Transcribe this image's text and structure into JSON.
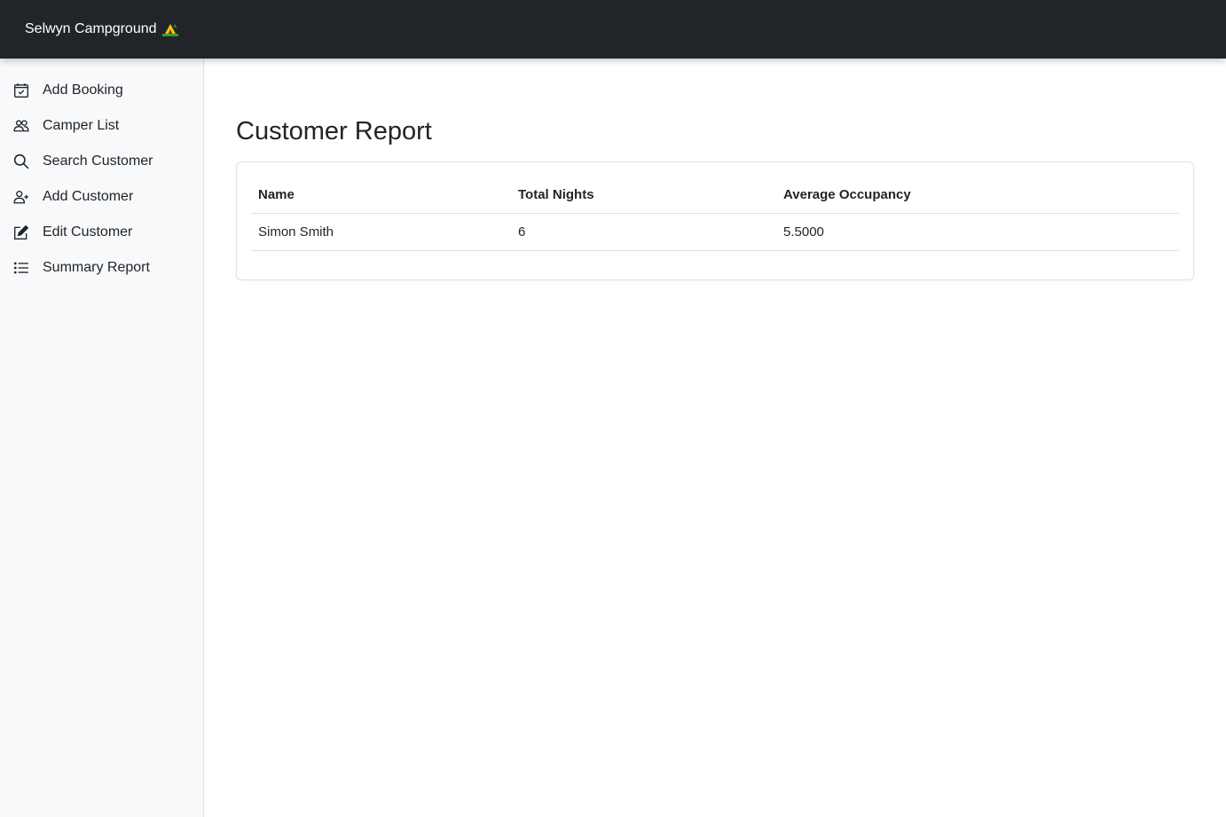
{
  "header": {
    "brand": "Selwyn Campground",
    "brand_icon": "camping-tent-icon"
  },
  "sidebar": {
    "items": [
      {
        "label": "Add Booking",
        "icon": "calendar-check-icon"
      },
      {
        "label": "Camper List",
        "icon": "people-icon"
      },
      {
        "label": "Search Customer",
        "icon": "search-icon"
      },
      {
        "label": "Add Customer",
        "icon": "person-add-icon"
      },
      {
        "label": "Edit Customer",
        "icon": "pencil-square-icon"
      },
      {
        "label": "Summary Report",
        "icon": "list-icon"
      }
    ]
  },
  "main": {
    "title": "Customer Report",
    "table": {
      "headers": [
        "Name",
        "Total Nights",
        "Average Occupancy"
      ],
      "rows": [
        [
          "Simon Smith",
          "6",
          "5.5000"
        ]
      ]
    }
  },
  "colors": {
    "topbar_bg": "#212529",
    "sidebar_bg": "#f8f9fa",
    "text": "#212529",
    "border": "#dee2e6"
  }
}
